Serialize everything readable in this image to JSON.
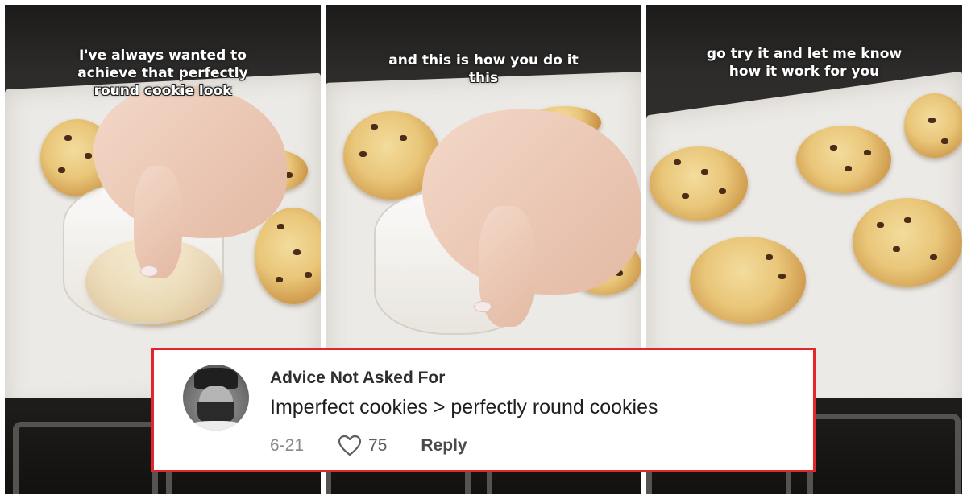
{
  "panels": [
    {
      "caption_lines": [
        "I've always wanted to",
        "achieve that perfectly",
        "round cookie look"
      ]
    },
    {
      "caption_lines": [
        "and this is how you do it",
        "this"
      ]
    },
    {
      "caption_lines": [
        "go try it and let me know",
        "how it work for you"
      ]
    }
  ],
  "comment": {
    "username": "Advice Not Asked For",
    "text": "Imperfect cookies > perfectly round cookies",
    "date": "6-21",
    "likes": "75",
    "reply_label": "Reply",
    "like_icon": "heart-outline-icon"
  },
  "colors": {
    "card_border": "#e3262b",
    "username": "#2e2e2e",
    "date": "#8a8a8a"
  }
}
